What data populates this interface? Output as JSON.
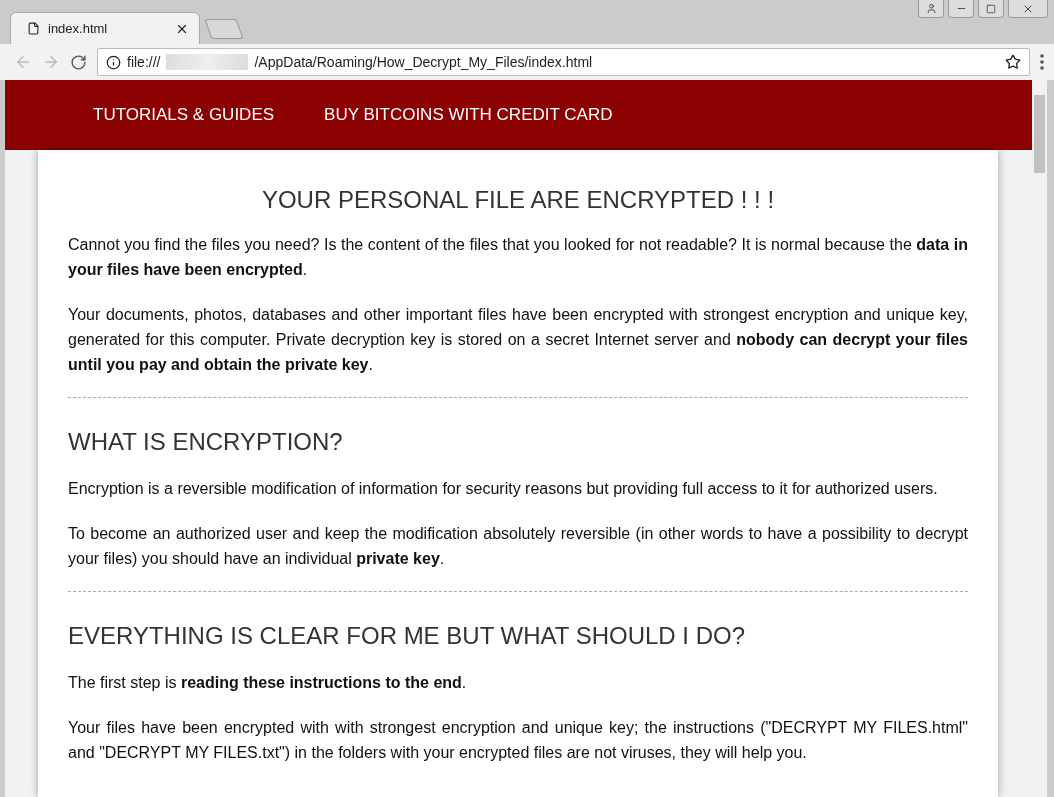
{
  "browser": {
    "tab": {
      "title": "index.html",
      "selected": true
    },
    "address": {
      "prefix": "file:///",
      "suffix": "/AppData/Roaming/How_Decrypt_My_Files/index.html"
    }
  },
  "nav": [
    "TUTORIALS & GUIDES",
    "BUY BITCOINS WITH CREDIT CARD"
  ],
  "title": "YOUR PERSONAL FILE ARE ENCRYPTED ! ! !",
  "sections": [
    {
      "paragraphs": [
        "Cannot you find the files you need? Is the content of the files that you looked for not readable? It is normal because the **data in your files have been encrypted**.",
        "Your documents, photos, databases and other important files have been encrypted with strongest encryption and unique key, generated for this computer. Private decryption key is stored on a secret Internet server and **nobody can decrypt your files until you pay and obtain the private key**."
      ]
    },
    {
      "heading": "WHAT IS ENCRYPTION?",
      "paragraphs": [
        "Encryption is a reversible modification of information for security reasons but providing full access to it for authorized users.",
        "To become an authorized user and keep the modification absolutely reversible (in other words to have a possibility to decrypt your files) you should have an individual **private key**."
      ]
    },
    {
      "heading": "EVERYTHING IS CLEAR FOR ME BUT WHAT SHOULD I DO?",
      "paragraphs": [
        "The first step is **reading these instructions to the end**.",
        "Your files have been encrypted with with strongest encryption and unique key; the instructions (\"DECRYPT MY FILES.html\" and \"DECRYPT MY FILES.txt\") in the folders with your encrypted files are not viruses, they will help you."
      ]
    }
  ]
}
